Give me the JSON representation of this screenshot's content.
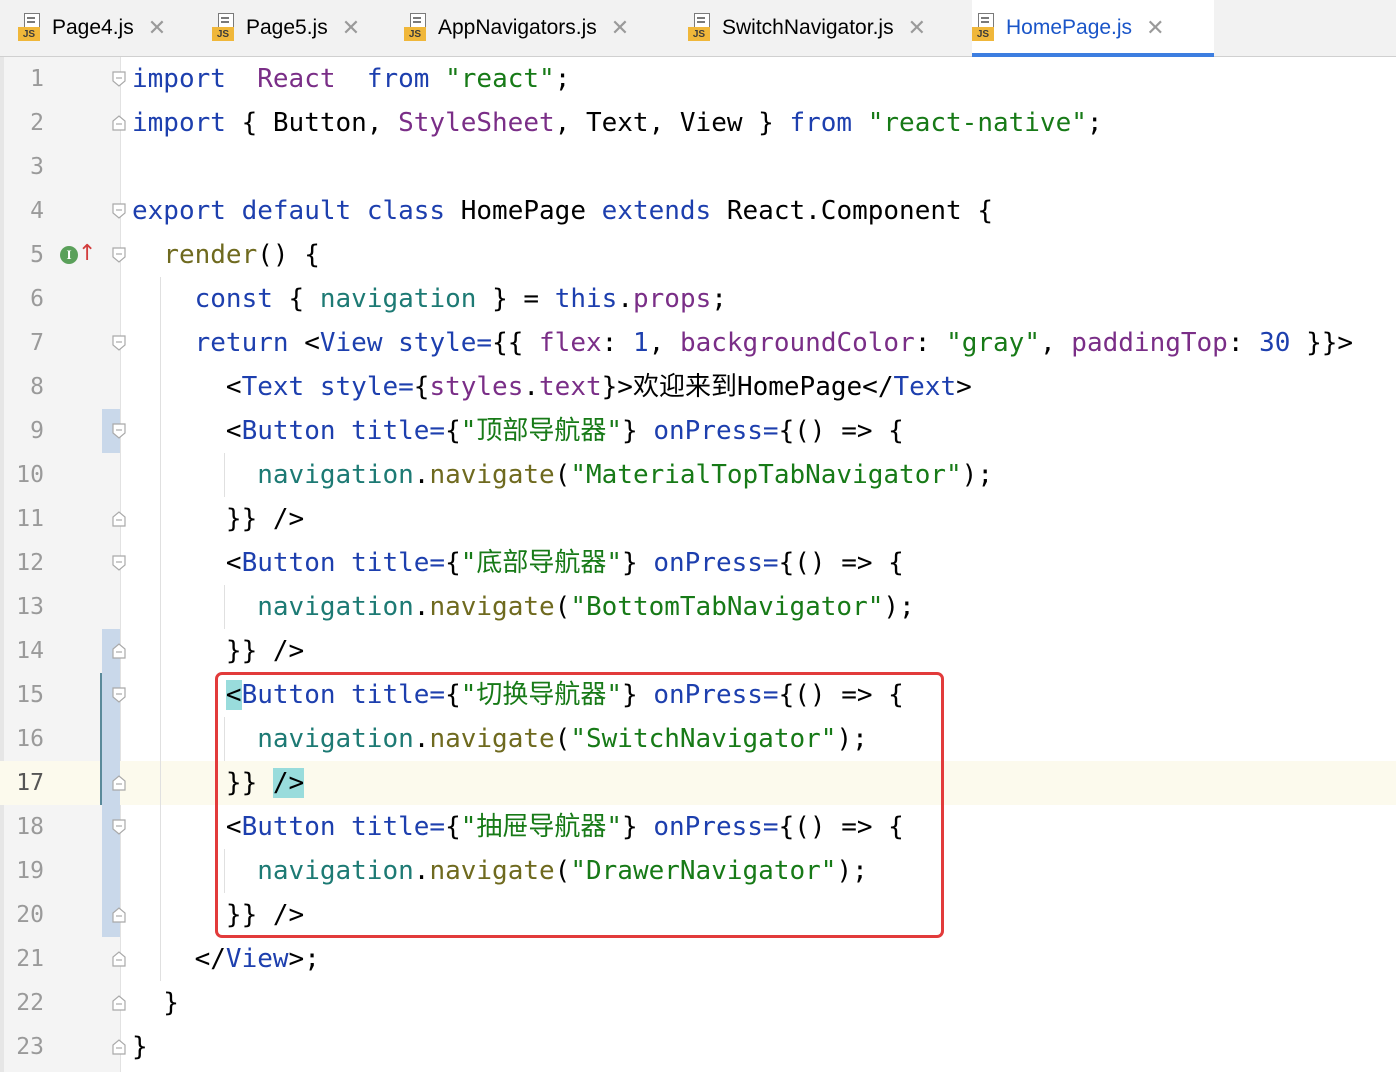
{
  "tabs": [
    {
      "label": "Page4.js",
      "icon": "js-file-icon",
      "badge": "JS",
      "close": "✕",
      "active": false
    },
    {
      "label": "Page5.js",
      "icon": "js-file-icon",
      "badge": "JS",
      "close": "✕",
      "active": false
    },
    {
      "label": "AppNavigators.js",
      "icon": "js-file-icon",
      "badge": "JS",
      "close": "✕",
      "active": false
    },
    {
      "label": "SwitchNavigator.js",
      "icon": "js-file-icon",
      "badge": "JS",
      "close": "✕",
      "active": false
    },
    {
      "label": "HomePage.js",
      "icon": "js-file-icon",
      "badge": "JS",
      "close": "✕",
      "active": true
    }
  ],
  "editor": {
    "current_line": 17,
    "line_numbers": [
      "1",
      "2",
      "3",
      "4",
      "5",
      "6",
      "7",
      "8",
      "9",
      "10",
      "11",
      "12",
      "13",
      "14",
      "15",
      "16",
      "17",
      "18",
      "19",
      "20",
      "21",
      "22",
      "23"
    ],
    "gutter_marker": {
      "line": 5,
      "icon": "implements-icon",
      "letter": "I",
      "arrow": "↑"
    },
    "highlight_box_lines": [
      15,
      20
    ],
    "colors": {
      "keyword": "#1d3fae",
      "string": "#177a17",
      "class": "#7a2e87",
      "highlight_box": "#e23b3b",
      "active_tab": "#1a55c8"
    },
    "lines": [
      [
        [
          "kw",
          "import"
        ],
        [
          "",
          "  "
        ],
        [
          "cls",
          "React"
        ],
        [
          "",
          "  "
        ],
        [
          "kw",
          "from"
        ],
        [
          "",
          " "
        ],
        [
          "str",
          "\"react\""
        ],
        [
          "",
          ";"
        ]
      ],
      [
        [
          "kw",
          "import"
        ],
        [
          "",
          " { Button, "
        ],
        [
          "cls",
          "StyleSheet"
        ],
        [
          "",
          ", Text, View } "
        ],
        [
          "kw",
          "from"
        ],
        [
          "",
          " "
        ],
        [
          "str",
          "\"react-native\""
        ],
        [
          "",
          ";"
        ]
      ],
      [],
      [
        [
          "kw",
          "export"
        ],
        [
          "",
          " "
        ],
        [
          "kw",
          "default"
        ],
        [
          "",
          " "
        ],
        [
          "kw",
          "class"
        ],
        [
          "",
          " HomePage "
        ],
        [
          "kw",
          "extends"
        ],
        [
          "",
          " React.Component {"
        ]
      ],
      [
        [
          "",
          "  "
        ],
        [
          "fn",
          "render"
        ],
        [
          "",
          "() {"
        ]
      ],
      [
        [
          "",
          "    "
        ],
        [
          "kw",
          "const"
        ],
        [
          "",
          " { "
        ],
        [
          "var",
          "navigation"
        ],
        [
          "",
          " } = "
        ],
        [
          "kw",
          "this"
        ],
        [
          "",
          "."
        ],
        [
          "prop",
          "props"
        ],
        [
          "",
          ";"
        ]
      ],
      [
        [
          "",
          "    "
        ],
        [
          "kw",
          "return"
        ],
        [
          "",
          " <"
        ],
        [
          "tag",
          "View"
        ],
        [
          "",
          " "
        ],
        [
          "attr",
          "style="
        ],
        [
          "",
          "{{ "
        ],
        [
          "prop",
          "flex"
        ],
        [
          "",
          ": "
        ],
        [
          "num",
          "1"
        ],
        [
          "",
          ", "
        ],
        [
          "prop",
          "backgroundColor"
        ],
        [
          "",
          ": "
        ],
        [
          "str",
          "\"gray\""
        ],
        [
          "",
          ", "
        ],
        [
          "prop",
          "paddingTop"
        ],
        [
          "",
          ": "
        ],
        [
          "num",
          "30"
        ],
        [
          "",
          " }}>"
        ]
      ],
      [
        [
          "",
          "      <"
        ],
        [
          "tag",
          "Text"
        ],
        [
          "",
          " "
        ],
        [
          "attr",
          "style="
        ],
        [
          "",
          "{"
        ],
        [
          "prop",
          "styles"
        ],
        [
          "",
          "."
        ],
        [
          "prop",
          "text"
        ],
        [
          "",
          "}>欢迎来到HomePage</"
        ],
        [
          "tag",
          "Text"
        ],
        [
          "",
          ">"
        ]
      ],
      [
        [
          "",
          "      <"
        ],
        [
          "tag",
          "Button"
        ],
        [
          "",
          " "
        ],
        [
          "attr",
          "title="
        ],
        [
          "",
          "{"
        ],
        [
          "str",
          "\"顶部导航器\""
        ],
        [
          "",
          "} "
        ],
        [
          "attr",
          "onPress="
        ],
        [
          "",
          "{() => {"
        ]
      ],
      [
        [
          "",
          "        "
        ],
        [
          "var",
          "navigation"
        ],
        [
          "",
          "."
        ],
        [
          "fn",
          "navigate"
        ],
        [
          "",
          "("
        ],
        [
          "str",
          "\"MaterialTopTabNavigator\""
        ],
        [
          "",
          ");"
        ]
      ],
      [
        [
          "",
          "      }} />"
        ]
      ],
      [
        [
          "",
          "      <"
        ],
        [
          "tag",
          "Button"
        ],
        [
          "",
          " "
        ],
        [
          "attr",
          "title="
        ],
        [
          "",
          "{"
        ],
        [
          "str",
          "\"底部导航器\""
        ],
        [
          "",
          "} "
        ],
        [
          "attr",
          "onPress="
        ],
        [
          "",
          "{() => {"
        ]
      ],
      [
        [
          "",
          "        "
        ],
        [
          "var",
          "navigation"
        ],
        [
          "",
          "."
        ],
        [
          "fn",
          "navigate"
        ],
        [
          "",
          "("
        ],
        [
          "str",
          "\"BottomTabNavigator\""
        ],
        [
          "",
          ");"
        ]
      ],
      [
        [
          "",
          "      }} />"
        ]
      ],
      [
        [
          "",
          "      "
        ],
        [
          "hl",
          "<"
        ],
        [
          "tag",
          "Button"
        ],
        [
          "",
          " "
        ],
        [
          "attr",
          "title="
        ],
        [
          "",
          "{"
        ],
        [
          "str",
          "\"切换导航器\""
        ],
        [
          "",
          "} "
        ],
        [
          "attr",
          "onPress="
        ],
        [
          "",
          "{() => {"
        ]
      ],
      [
        [
          "",
          "        "
        ],
        [
          "var",
          "navigation"
        ],
        [
          "",
          "."
        ],
        [
          "fn",
          "navigate"
        ],
        [
          "",
          "("
        ],
        [
          "str",
          "\"SwitchNavigator\""
        ],
        [
          "",
          ");"
        ]
      ],
      [
        [
          "",
          "      }} "
        ],
        [
          "hl",
          "/>"
        ]
      ],
      [
        [
          "",
          "      <"
        ],
        [
          "tag",
          "Button"
        ],
        [
          "",
          " "
        ],
        [
          "attr",
          "title="
        ],
        [
          "",
          "{"
        ],
        [
          "str",
          "\"抽屉导航器\""
        ],
        [
          "",
          "} "
        ],
        [
          "attr",
          "onPress="
        ],
        [
          "",
          "{() => {"
        ]
      ],
      [
        [
          "",
          "        "
        ],
        [
          "var",
          "navigation"
        ],
        [
          "",
          "."
        ],
        [
          "fn",
          "navigate"
        ],
        [
          "",
          "("
        ],
        [
          "str",
          "\"DrawerNavigator\""
        ],
        [
          "",
          ");"
        ]
      ],
      [
        [
          "",
          "      }} />"
        ]
      ],
      [
        [
          "",
          "    </"
        ],
        [
          "tag",
          "View"
        ],
        [
          "",
          ">;"
        ]
      ],
      [
        [
          "",
          "  }"
        ]
      ],
      [
        [
          "",
          "}"
        ]
      ]
    ]
  }
}
